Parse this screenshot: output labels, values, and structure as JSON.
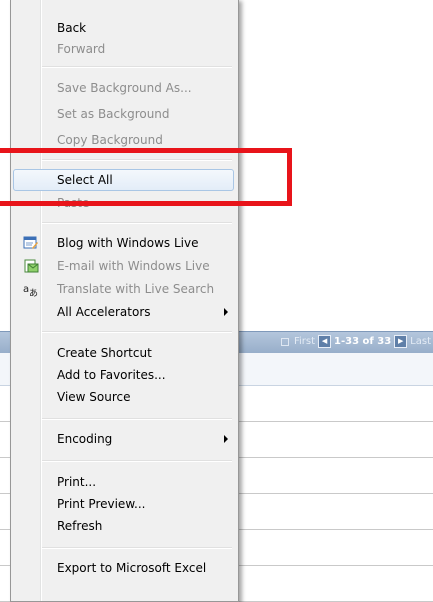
{
  "pager": {
    "first": "First",
    "range": "1-33 of 33",
    "last": "Last"
  },
  "menu": {
    "back": "Back",
    "forward": "Forward",
    "save_background": "Save Background As...",
    "set_background": "Set as Background",
    "copy_background": "Copy Background",
    "select_all": "Select All",
    "paste": "Paste",
    "blog": "Blog with Windows Live",
    "email": "E-mail with Windows Live",
    "translate": "Translate with Live Search",
    "all_accelerators": "All Accelerators",
    "create_shortcut": "Create Shortcut",
    "add_favorites": "Add to Favorites...",
    "view_source": "View Source",
    "encoding": "Encoding",
    "print": "Print...",
    "print_preview": "Print Preview...",
    "refresh": "Refresh",
    "export_excel": "Export to Microsoft Excel"
  },
  "icons": {
    "blog": "blog-icon",
    "email": "email-icon",
    "translate": "translate-icon"
  },
  "colors": {
    "highlight": "#e8141a",
    "pager_bar": "#a5bad4",
    "hover_border": "#a9c6e5"
  }
}
